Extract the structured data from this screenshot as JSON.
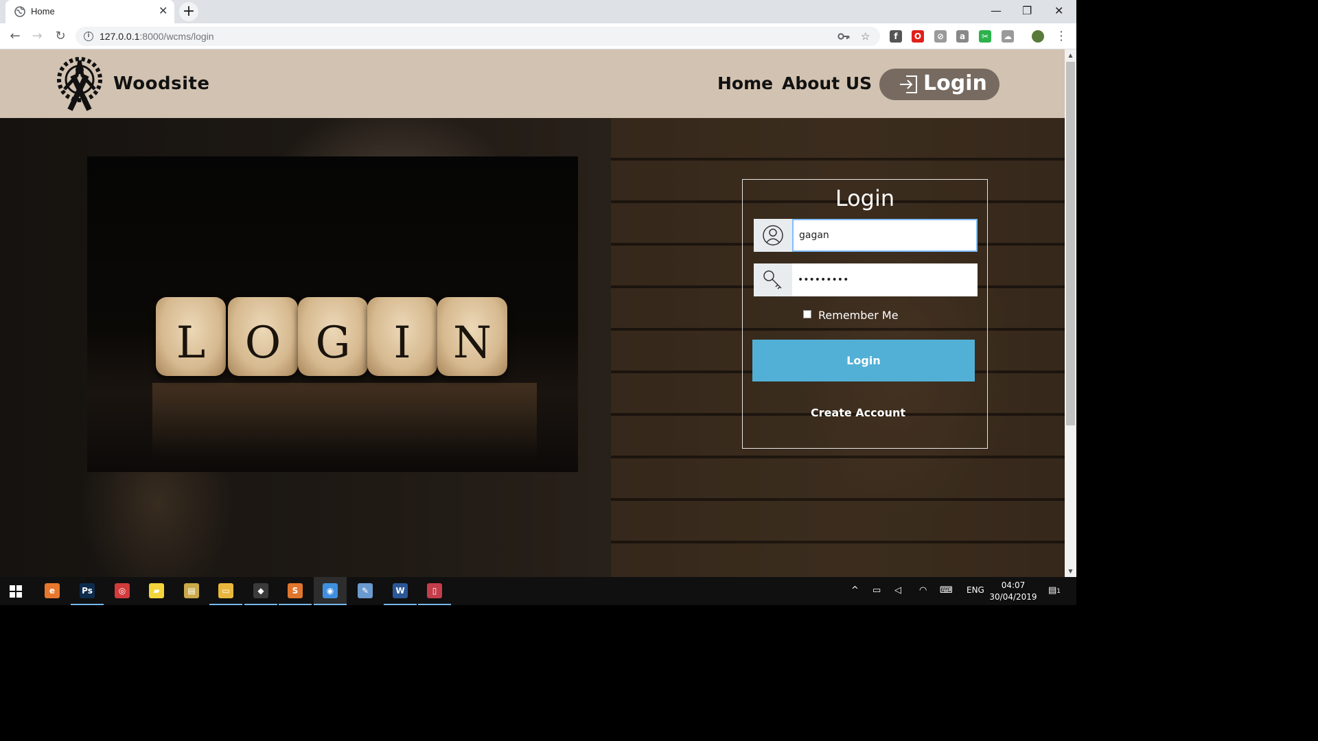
{
  "browser": {
    "tab": {
      "title": "Home",
      "close": "✕"
    },
    "new_tab": "+",
    "window": {
      "minimize": "—",
      "restore": "❐",
      "close": "✕"
    },
    "nav": {
      "back": "←",
      "forward": "→",
      "reload": "↻"
    },
    "url": {
      "host": "127.0.0.1",
      "rest": ":8000/wcms/login"
    },
    "omnibox_icons": {
      "key": "key-icon",
      "star": "☆"
    },
    "extensions": [
      {
        "name": "facebook-extension-icon",
        "glyph": "f",
        "color": "#555555"
      },
      {
        "name": "opera-extension-icon",
        "glyph": "O",
        "color": "#e0201b"
      },
      {
        "name": "speed-extension-icon",
        "glyph": "⊘",
        "color": "#9a9a9a"
      },
      {
        "name": "shopping-extension-icon",
        "glyph": "a",
        "color": "#888888"
      },
      {
        "name": "green-extension-icon",
        "glyph": "✂",
        "color": "#2bb24c"
      },
      {
        "name": "cloud-extension-icon",
        "glyph": "☁",
        "color": "#9a9a9a"
      }
    ],
    "menu": "⋮"
  },
  "site": {
    "brand": "Woodsite",
    "nav": {
      "home": "Home",
      "about": "About US",
      "login": "Login"
    }
  },
  "hero": {
    "image_letters": [
      "L",
      "O",
      "G",
      "I",
      "N"
    ]
  },
  "login_form": {
    "title": "Login",
    "username_value": "gagan",
    "password_value": "•••••••••",
    "remember_label": "Remember Me",
    "submit_label": "Login",
    "create_account": "Create Account"
  },
  "taskbar": {
    "apps": [
      {
        "name": "edge-taskbar-icon",
        "glyph": "e",
        "color": "#e8772e",
        "running": false
      },
      {
        "name": "photoshop-taskbar-icon",
        "glyph": "Ps",
        "color": "#0d2c4d",
        "running": true
      },
      {
        "name": "chromium-taskbar-icon",
        "glyph": "◎",
        "color": "#d23b3b",
        "running": false
      },
      {
        "name": "sticky-notes-taskbar-icon",
        "glyph": "▰",
        "color": "#f3d53b",
        "running": false
      },
      {
        "name": "notes-taskbar-icon",
        "glyph": "▤",
        "color": "#caa94a",
        "running": false
      },
      {
        "name": "file-explorer-taskbar-icon",
        "glyph": "▭",
        "color": "#e9b73c",
        "running": true
      },
      {
        "name": "git-taskbar-icon",
        "glyph": "◆",
        "color": "#3a3a3a",
        "running": true
      },
      {
        "name": "sublime-taskbar-icon",
        "glyph": "S",
        "color": "#e0762d",
        "running": true
      },
      {
        "name": "chrome-taskbar-icon",
        "glyph": "◉",
        "color": "#3f8fe0",
        "running": true,
        "active": true
      },
      {
        "name": "paint-taskbar-icon",
        "glyph": "✎",
        "color": "#6a9ad0",
        "running": false
      },
      {
        "name": "word-taskbar-icon",
        "glyph": "W",
        "color": "#2b5797",
        "running": true
      },
      {
        "name": "phone-taskbar-icon",
        "glyph": "▯",
        "color": "#c33d4a",
        "running": true
      }
    ],
    "tray": {
      "chevron": "^",
      "language": "ENG",
      "time": "04:07",
      "date": "30/04/2019",
      "notifications": "1"
    }
  },
  "colors": {
    "header_bg": "#d2c2b1",
    "nav_login_bg": "#776b61",
    "submit_bg": "#52b0d6",
    "taskbar_bg": "#101010"
  }
}
